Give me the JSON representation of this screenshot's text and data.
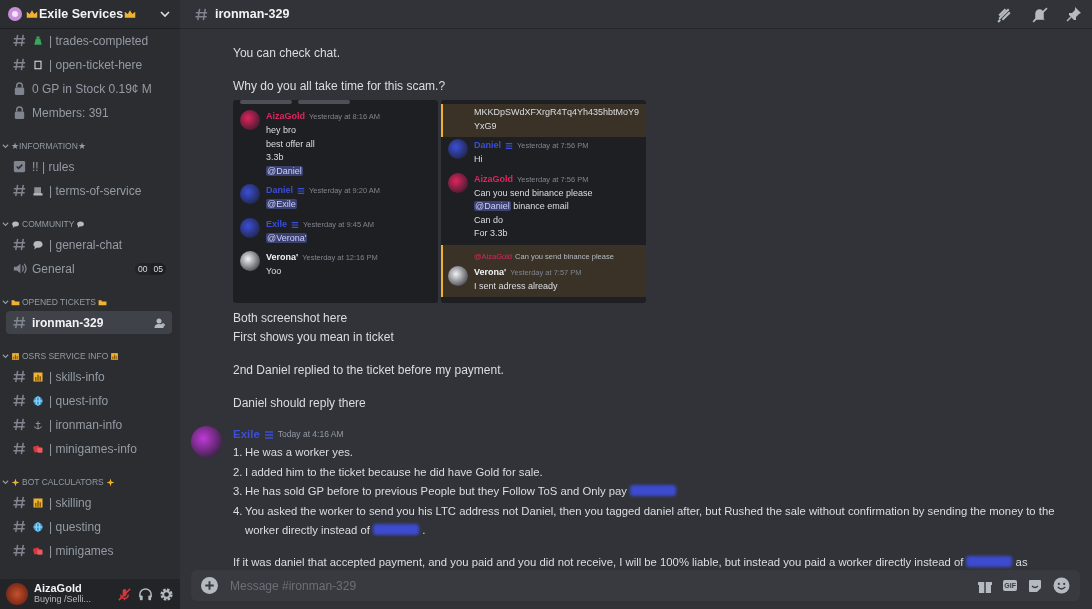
{
  "server": {
    "name": "Exile Services"
  },
  "sidebar": {
    "items": [
      {
        "kind": "text",
        "label": "| trades-completed",
        "selected": false
      },
      {
        "kind": "text",
        "label": "| open-ticket-here",
        "selected": false
      },
      {
        "kind": "locked",
        "label": "0 GP in Stock 0.19¢ M",
        "selected": false
      },
      {
        "kind": "locked",
        "label": "Members: 391",
        "selected": false
      },
      {
        "kind": "category",
        "label": "★INFORMATION★"
      },
      {
        "kind": "rules",
        "label": "!! | rules",
        "selected": false
      },
      {
        "kind": "text",
        "label": "| terms-of-service",
        "selected": false
      },
      {
        "kind": "category",
        "label": "COMMUNITY"
      },
      {
        "kind": "text",
        "label": "| general-chat",
        "selected": false
      },
      {
        "kind": "voice",
        "label": "General",
        "count": "00",
        "limit": "05",
        "selected": false
      },
      {
        "kind": "category",
        "label": "OPENED TICKETS"
      },
      {
        "kind": "text",
        "label": "ironman-329",
        "selected": true
      },
      {
        "kind": "category",
        "label": "OSRS SERVICE INFO"
      },
      {
        "kind": "text",
        "label": "| skills-info",
        "selected": false
      },
      {
        "kind": "text",
        "label": "| quest-info",
        "selected": false
      },
      {
        "kind": "text",
        "label": "| ironman-info",
        "selected": false
      },
      {
        "kind": "text",
        "label": "| minigames-info",
        "selected": false
      },
      {
        "kind": "category",
        "label": "BOT CALCULATORS"
      },
      {
        "kind": "text",
        "label": "| skilling",
        "selected": false
      },
      {
        "kind": "text",
        "label": "| questing",
        "selected": false
      },
      {
        "kind": "text",
        "label": "| minigames",
        "selected": false
      }
    ]
  },
  "user_panel": {
    "name": "AizaGold",
    "status": "Buying /Selli...",
    "muted": true
  },
  "header": {
    "channel": "ironman-329"
  },
  "messages": [
    {
      "kind": "lines",
      "paragraphs": [
        [
          "You can check chat."
        ],
        [
          "Why do you all take time for this scam.?"
        ]
      ]
    },
    {
      "kind": "screenshot",
      "left": [
        {
          "author": "AizaGold",
          "color": "#e0245e",
          "time": "Yesterday at 8:16 AM",
          "lines": [
            {
              "text": "hey bro"
            },
            {
              "text": "best offer all"
            },
            {
              "text": "3.3b"
            },
            {
              "mention": "@Daniel"
            }
          ]
        },
        {
          "author": "Daniel",
          "color": "#3b4fd8",
          "badge": true,
          "time": "Yesterday at 9:20 AM",
          "lines": [
            {
              "mention": "@Exile"
            }
          ]
        },
        {
          "author": "Exile",
          "color": "#3b4fd8",
          "badge": true,
          "time": "Yesterday at 9:45 AM",
          "lines": [
            {
              "mention": "@Verona'"
            }
          ]
        },
        {
          "author": "Verona'",
          "color": "#f2f3f5",
          "time": "Yesterday at 12:16 PM",
          "lines": [
            {
              "text": "Yoo"
            }
          ]
        }
      ],
      "right": [
        {
          "highlight": true,
          "lines": [
            {
              "text": "MKKDpSWdXFXrgR4Tq4Yh435hbtMoY9"
            },
            {
              "text": "YxG9"
            }
          ]
        },
        {
          "author": "Daniel",
          "color": "#3b4fd8",
          "badge": true,
          "time": "Yesterday at 7:56 PM",
          "lines": [
            {
              "text": "Hi"
            }
          ]
        },
        {
          "author": "AizaGold",
          "color": "#e0245e",
          "time": "Yesterday at 7:56 PM",
          "lines": [
            {
              "text": "Can you send binance please"
            },
            {
              "mention": "@Daniel",
              "text": " binance email"
            },
            {
              "text": "Can do"
            },
            {
              "text": "For 3.3b"
            }
          ]
        },
        {
          "highlight": true,
          "reply": {
            "mention": "@AizaGold",
            "text": "Can you send binance please"
          },
          "author": "Verona'",
          "color": "#f2f3f5",
          "time": "Yesterday at 7:57 PM",
          "lines": [
            {
              "text": "I sent adress already"
            }
          ]
        }
      ]
    },
    {
      "kind": "lines",
      "paragraphs": [
        [
          "Both screenshot here",
          "First shows you mean in ticket"
        ],
        [
          "2nd Daniel replied to the ticket before my payment."
        ],
        [
          "Daniel should reply there"
        ]
      ]
    },
    {
      "kind": "post",
      "author": "Exile",
      "color": "#3b4fd8",
      "badge": true,
      "time": "Today at 4:16 AM",
      "list": [
        {
          "number": "1.",
          "parts": [
            {
              "kind": "text",
              "text": "He was a worker yes."
            }
          ]
        },
        {
          "number": "2.",
          "parts": [
            {
              "kind": "text",
              "text": "I added him to the ticket because he did have Gold for sale."
            }
          ]
        },
        {
          "number": "3.",
          "parts": [
            {
              "kind": "text",
              "text": "He has sold GP before to previous People but they Follow ToS and Only pay "
            },
            {
              "kind": "redacted"
            }
          ]
        },
        {
          "number": "4.",
          "parts": [
            {
              "kind": "text",
              "text": "You asked the worker to send you his LTC address not Daniel, then you tagged daniel after, but Rushed the sale without confirmation by sending the money to the worker directly instead of "
            },
            {
              "kind": "redacted"
            },
            {
              "kind": "text",
              "text": " ."
            }
          ]
        }
      ],
      "after": [
        {
          "kind": "text",
          "text": "If it was daniel that accepted payment, and you paid and you did not receive, I will be 100% liable, but instead you paid a worker directly instead of "
        },
        {
          "kind": "redacted"
        },
        {
          "kind": "text",
          "text": " as"
        }
      ]
    }
  ],
  "composer": {
    "placeholder": "Message #ironman-329",
    "gif": "GIF"
  }
}
